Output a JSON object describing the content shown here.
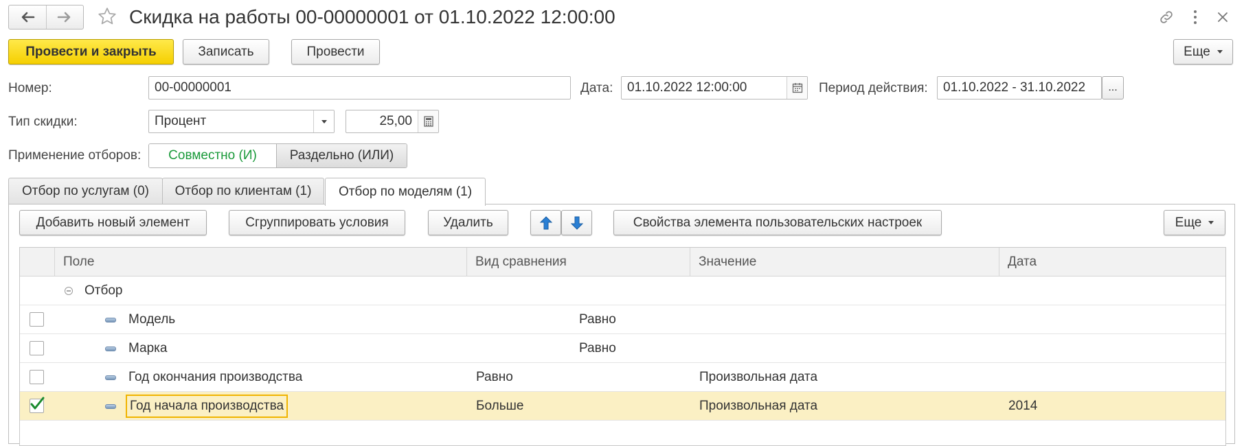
{
  "window": {
    "title": "Скидка на работы 00-00000001 от 01.10.2022 12:00:00"
  },
  "toolbar": {
    "post_close": "Провести и закрыть",
    "save": "Записать",
    "post": "Провести",
    "more": "Еще"
  },
  "form": {
    "number_label": "Номер:",
    "number_value": "00-00000001",
    "date_label": "Дата:",
    "date_value": "01.10.2022 12:00:00",
    "period_label": "Период действия:",
    "period_value": "01.10.2022 - 31.10.2022",
    "period_button": "...",
    "discount_type_label": "Тип скидки:",
    "discount_type_value": "Процент",
    "discount_amount": "25,00",
    "filter_mode_label": "Применение отборов:",
    "filter_mode_options": [
      "Совместно (И)",
      "Раздельно (ИЛИ)"
    ],
    "filter_mode_selected": "Совместно (И)"
  },
  "tabs": [
    {
      "label": "Отбор по услугам (0)"
    },
    {
      "label": "Отбор по клиентам (1)"
    },
    {
      "label": "Отбор по моделям (1)"
    }
  ],
  "active_tab": "Отбор по моделям (1)",
  "panel_toolbar": {
    "add": "Добавить новый элемент",
    "group": "Сгруппировать условия",
    "delete": "Удалить",
    "properties": "Свойства элемента пользовательских настроек",
    "more": "Еще"
  },
  "table": {
    "columns": [
      "Поле",
      "Вид сравнения",
      "Значение",
      "Дата"
    ],
    "group_label": "Отбор",
    "rows": [
      {
        "checked": false,
        "field": "Модель",
        "comparison": "Равно",
        "value": "",
        "date": ""
      },
      {
        "checked": false,
        "field": "Марка",
        "comparison": "Равно",
        "value": "",
        "date": ""
      },
      {
        "checked": false,
        "field": "Год окончания производства",
        "comparison": "Равно",
        "value": "Произвольная дата",
        "date": ""
      },
      {
        "checked": true,
        "field": "Год начала производства",
        "comparison": "Больше",
        "value": "Произвольная дата",
        "date": "2014"
      }
    ]
  },
  "colors": {
    "primary_button": "#f5cf00",
    "selected_row": "#fbf0c4",
    "active_toggle_text": "#1a9a3a",
    "arrow_blue": "#2a7fd4",
    "check_green": "#1a8a2e"
  }
}
